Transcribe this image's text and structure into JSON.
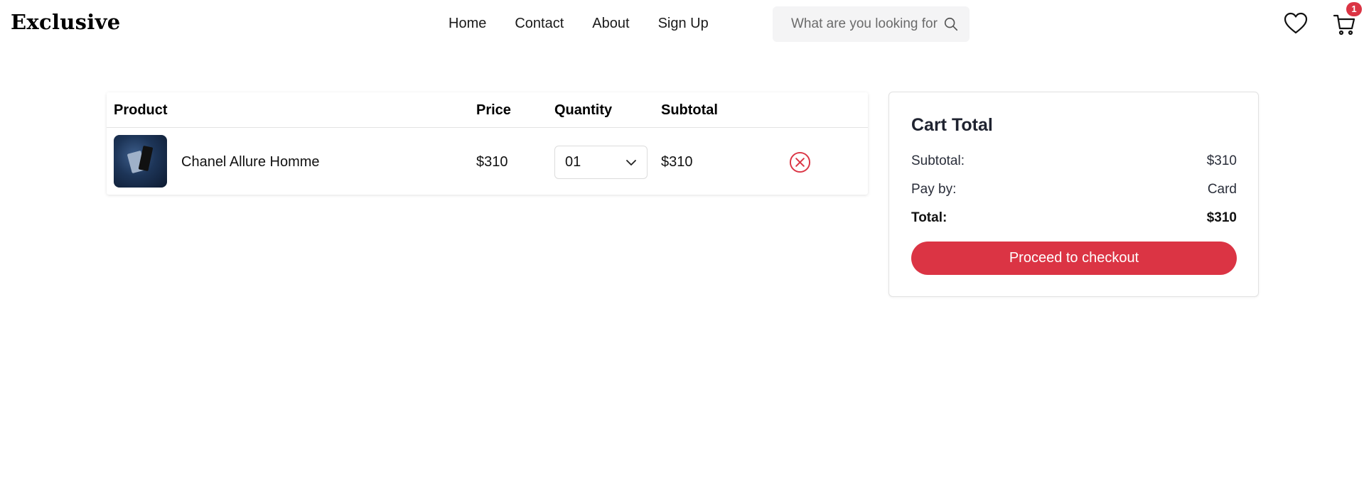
{
  "header": {
    "logo": "Exclusive",
    "nav": [
      {
        "label": "Home"
      },
      {
        "label": "Contact"
      },
      {
        "label": "About"
      },
      {
        "label": "Sign Up"
      }
    ],
    "search": {
      "placeholder": "What are you looking for?",
      "icon": "search-icon"
    },
    "wishlist_icon": "heart-icon",
    "cart_icon": "cart-icon",
    "cart_count": "1"
  },
  "cart": {
    "columns": {
      "product": "Product",
      "price": "Price",
      "quantity": "Quantity",
      "subtotal": "Subtotal"
    },
    "items": [
      {
        "name": "Chanel Allure Homme",
        "price": "$310",
        "quantity": "01",
        "subtotal": "$310",
        "remove_icon": "remove-circle-icon"
      }
    ]
  },
  "summary": {
    "title": "Cart Total",
    "subtotal_label": "Subtotal:",
    "subtotal_value": "$310",
    "pay_label": "Pay by:",
    "pay_value": "Card",
    "total_label": "Total:",
    "total_value": "$310",
    "checkout_label": "Proceed to checkout"
  },
  "colors": {
    "accent": "#db3444",
    "search_bg": "#f4f4f5"
  }
}
